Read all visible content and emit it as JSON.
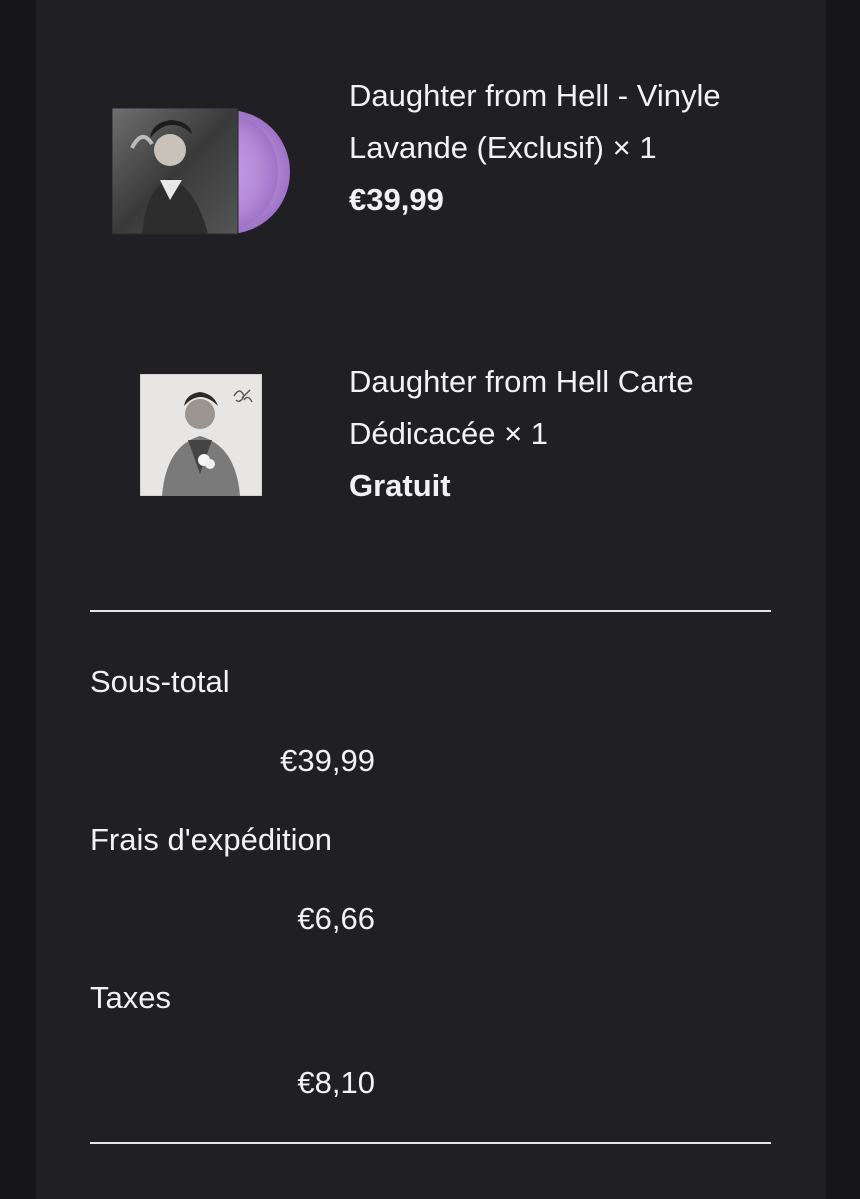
{
  "order": {
    "items": [
      {
        "name": "Daughter from Hell - Vinyle Lavande (Exclusif) × 1",
        "price": "€39,99",
        "image": "album-cover-with-lavender-vinyl"
      },
      {
        "name": "Daughter from Hell Carte Dédicacée × 1",
        "price": "Gratuit",
        "image": "signed-card-photo"
      }
    ],
    "summary": {
      "subtotal_label": "Sous-total",
      "subtotal_value": "€39,99",
      "shipping_label": "Frais d'expédition",
      "shipping_value": "€6,66",
      "taxes_label": "Taxes",
      "taxes_value": "€8,10"
    },
    "colors": {
      "background": "#17171a",
      "panel": "#202024",
      "text": "#f2f2f4",
      "vinyl_accent": "#b58bd8"
    }
  }
}
